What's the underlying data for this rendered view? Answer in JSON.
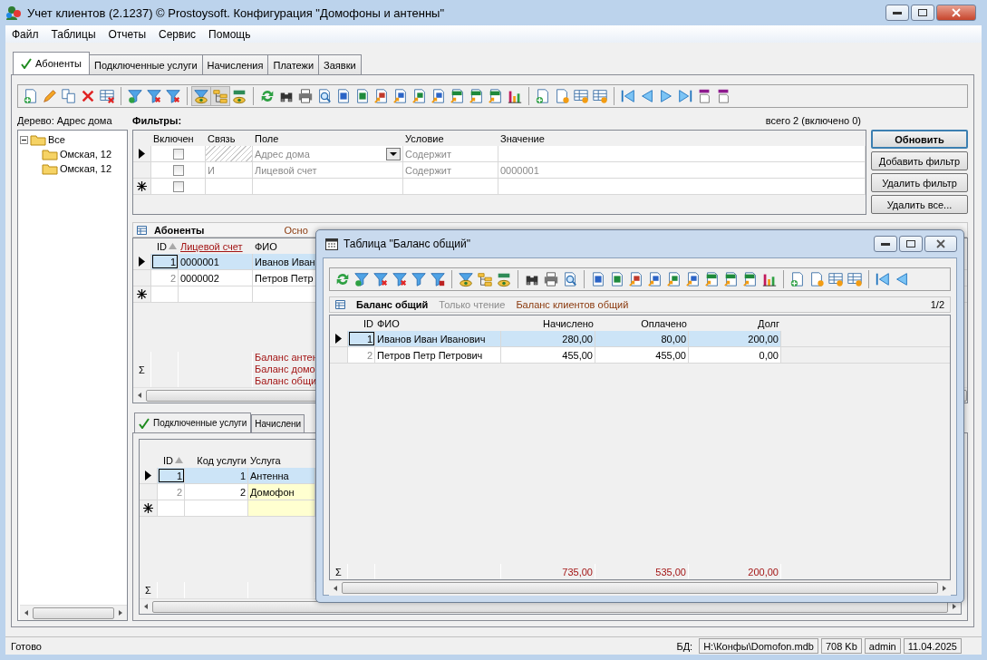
{
  "window": {
    "title": "Учет клиентов (2.1237) © Prostoysoft. Конфигурация \"Домофоны и антенны\""
  },
  "menu": [
    "Файл",
    "Таблицы",
    "Отчеты",
    "Сервис",
    "Помощь"
  ],
  "tabs": [
    {
      "label": "Абоненты",
      "selected": true
    },
    {
      "label": "Подключенные услуги",
      "selected": false
    },
    {
      "label": "Начисления",
      "selected": false
    },
    {
      "label": "Платежи",
      "selected": false
    },
    {
      "label": "Заявки",
      "selected": false
    }
  ],
  "tree": {
    "label": "Дерево: Адрес дома",
    "items": [
      {
        "label": "Все",
        "expanded": true,
        "children": [
          {
            "label": "Омская, 12"
          },
          {
            "label": "Омская, 12"
          }
        ]
      }
    ]
  },
  "filters": {
    "title": "Фильтры:",
    "summary": "всего 2 (включено 0)",
    "columns": [
      "Включен",
      "Связь",
      "Поле",
      "Условие",
      "Значение"
    ],
    "rows": [
      {
        "current": true,
        "enabled": false,
        "field": "Адрес дома",
        "condition": "Содержит"
      },
      {
        "current": false,
        "enabled": false,
        "link": "И",
        "field": "Лицевой счет",
        "condition": "Содержит",
        "value": "0000001"
      }
    ],
    "new_row": {
      "enabled": false
    }
  },
  "filter_buttons": [
    {
      "label": "Обновить",
      "default": true
    },
    {
      "label": "Добавить фильтр",
      "default": false
    },
    {
      "label": "Удалить фильтр",
      "default": false
    },
    {
      "label": "Удалить все...",
      "default": false
    }
  ],
  "subscribers": {
    "title": "Абоненты",
    "subtitle": "Осно",
    "columns": [
      {
        "label": "ID",
        "sorted": true,
        "highlighted": false
      },
      {
        "label": "Лицевой счет",
        "sorted": false,
        "highlighted": true
      },
      {
        "label": "ФИО",
        "sorted": false,
        "highlighted": false
      }
    ],
    "rows": [
      {
        "id": "1",
        "account": "0000001",
        "name": "Иванов Иван",
        "selected": true
      },
      {
        "id": "2",
        "account": "0000002",
        "name": "Петров Петр",
        "selected": false
      }
    ],
    "sum_mark": "Σ",
    "totals": [
      "Баланс антен",
      "Баланс домо",
      "Баланс общи"
    ]
  },
  "service_tabs": [
    {
      "label": "Подключенные услуги",
      "selected": true
    },
    {
      "label": "Начислени",
      "selected": false
    }
  ],
  "services": {
    "columns": [
      {
        "label": "ID",
        "sorted": true
      },
      {
        "label": "Код услуги",
        "sorted": false
      },
      {
        "label": "Услуга",
        "sorted": false
      }
    ],
    "rows": [
      {
        "id": "1",
        "code": "1",
        "service": "Антенна",
        "selected": true
      },
      {
        "id": "2",
        "code": "2",
        "service": "Домофон",
        "selected": false
      }
    ],
    "sum_mark": "Σ"
  },
  "dialog": {
    "title": "Таблица \"Баланс общий\"",
    "table_title": "Баланс общий",
    "mode": "Только чтение",
    "description": "Баланс клиентов общий",
    "page": "1/2",
    "columns": [
      "ID",
      "ФИО",
      "Начислено",
      "Оплачено",
      "Долг"
    ],
    "rows": [
      {
        "id": "1",
        "name": "Иванов Иван Иванович",
        "charged": "280,00",
        "paid": "80,00",
        "debt": "200,00",
        "selected": true
      },
      {
        "id": "2",
        "name": "Петров Петр Петрович",
        "charged": "455,00",
        "paid": "455,00",
        "debt": "0,00",
        "selected": false
      }
    ],
    "sum_mark": "Σ",
    "totals": [
      "735,00",
      "535,00",
      "200,00"
    ]
  },
  "status_bar": {
    "message": "Готово",
    "db_label": "БД:",
    "db_path": "H:\\Конфы\\Domofon.mdb",
    "size": "708 Kb",
    "user": "admin",
    "date": "11.04.2025"
  }
}
